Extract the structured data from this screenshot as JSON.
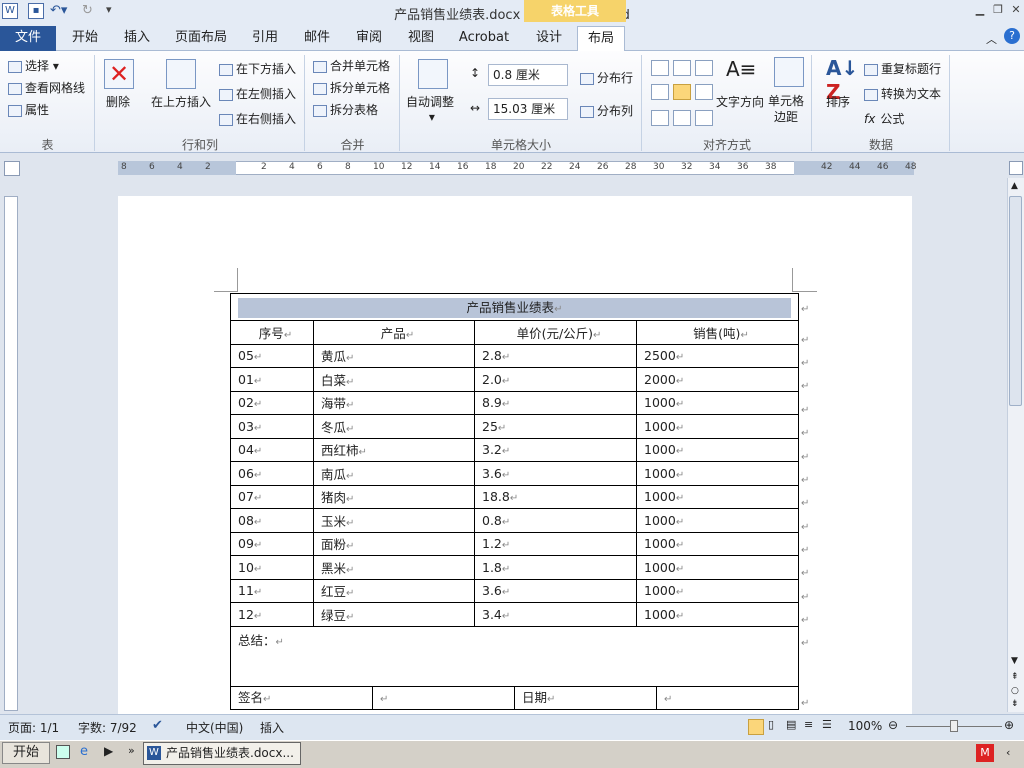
{
  "window": {
    "title": "产品销售业绩表.docx  -  Microsoft Word",
    "context_tools": "表格工具"
  },
  "tabs": [
    "文件",
    "开始",
    "插入",
    "页面布局",
    "引用",
    "邮件",
    "审阅",
    "视图",
    "Acrobat",
    "设计",
    "布局"
  ],
  "ribbon": {
    "table": {
      "select": "选择",
      "gridlines": "查看网格线",
      "properties": "属性",
      "label": "表"
    },
    "rows_cols": {
      "delete": "删除",
      "insert_above": "在上方插入",
      "insert_below": "在下方插入",
      "insert_left": "在左侧插入",
      "insert_right": "在右侧插入",
      "label": "行和列"
    },
    "merge": {
      "merge_cells": "合并单元格",
      "split_cells": "拆分单元格",
      "split_table": "拆分表格",
      "label": "合并"
    },
    "cell_size": {
      "autofit": "自动调整",
      "height": "0.8 厘米",
      "width": "15.03 厘米",
      "dist_rows": "分布行",
      "dist_cols": "分布列",
      "label": "单元格大小"
    },
    "alignment": {
      "text_direction": "文字方向",
      "cell_margins": "单元格\n边距",
      "label": "对齐方式"
    },
    "data": {
      "sort": "排序",
      "repeat_header": "重复标题行",
      "convert_text": "转换为文本",
      "formula": "公式",
      "label": "数据"
    }
  },
  "ruler": {
    "h_ticks": [
      "8",
      "6",
      "4",
      "2",
      "2",
      "4",
      "6",
      "8",
      "10",
      "12",
      "14",
      "16",
      "18",
      "20",
      "22",
      "24",
      "26",
      "28",
      "30",
      "32",
      "34",
      "36",
      "38",
      "42",
      "44",
      "46",
      "48"
    ]
  },
  "document": {
    "table_title": "产品销售业绩表",
    "headers": [
      "序号",
      "产品",
      "单价(元/公斤)",
      "销售(吨)"
    ],
    "rows": [
      [
        "05",
        "黄瓜",
        "2.8",
        "2500"
      ],
      [
        "01",
        "白菜",
        "2.0",
        "2000"
      ],
      [
        "02",
        "海带",
        "8.9",
        "1000"
      ],
      [
        "03",
        "冬瓜",
        "25",
        "1000"
      ],
      [
        "04",
        "西红柿",
        "3.2",
        "1000"
      ],
      [
        "06",
        "南瓜",
        "3.6",
        "1000"
      ],
      [
        "07",
        "猪肉",
        "18.8",
        "1000"
      ],
      [
        "08",
        "玉米",
        "0.8",
        "1000"
      ],
      [
        "09",
        "面粉",
        "1.2",
        "1000"
      ],
      [
        "10",
        "黑米",
        "1.8",
        "1000"
      ],
      [
        "11",
        "红豆",
        "3.6",
        "1000"
      ],
      [
        "12",
        "绿豆",
        "3.4",
        "1000"
      ]
    ],
    "summary_label": "总结：",
    "sign_label": "签名",
    "date_label": "日期"
  },
  "status": {
    "page": "页面: 1/1",
    "words": "字数: 7/92",
    "language": "中文(中国)",
    "mode": "插入",
    "zoom": "100%"
  },
  "taskbar": {
    "start": "开始",
    "item": "产品销售业绩表.docx..."
  }
}
